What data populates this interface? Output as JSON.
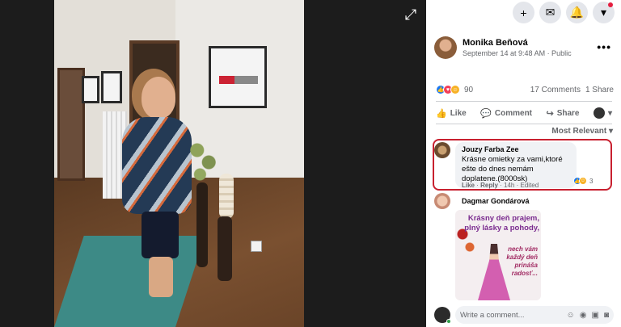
{
  "post": {
    "author": "Monika Beňová",
    "meta": "September 14 at 9:48 AM · Public",
    "more": "•••"
  },
  "stats": {
    "reaction_count": "90",
    "comments": "17 Comments",
    "shares": "1 Share"
  },
  "actions": {
    "like": "Like",
    "comment": "Comment",
    "share": "Share"
  },
  "sort_label": "Most Relevant ▾",
  "comments": [
    {
      "author": "Jouzy Farba Zee",
      "text": "Krásne omietky za vami,ktoré ešte do dnes nemám doplatene.(8000sk)",
      "like": "Like",
      "reply": "Reply",
      "time": "14h",
      "edited": "Edited",
      "reactions": "3"
    },
    {
      "author": "Dagmar Gondárová",
      "card_title": "Krásny deň prajem, plný lásky a pohody,",
      "card_sub": "nech vám každý deň prináša radosť..."
    }
  ],
  "composer": {
    "placeholder": "Write a comment..."
  },
  "icons": {
    "top": [
      "plus-icon",
      "messenger-icon",
      "bell-icon",
      "caret-down-icon"
    ],
    "fullscreen": "fullscreen-icon"
  }
}
